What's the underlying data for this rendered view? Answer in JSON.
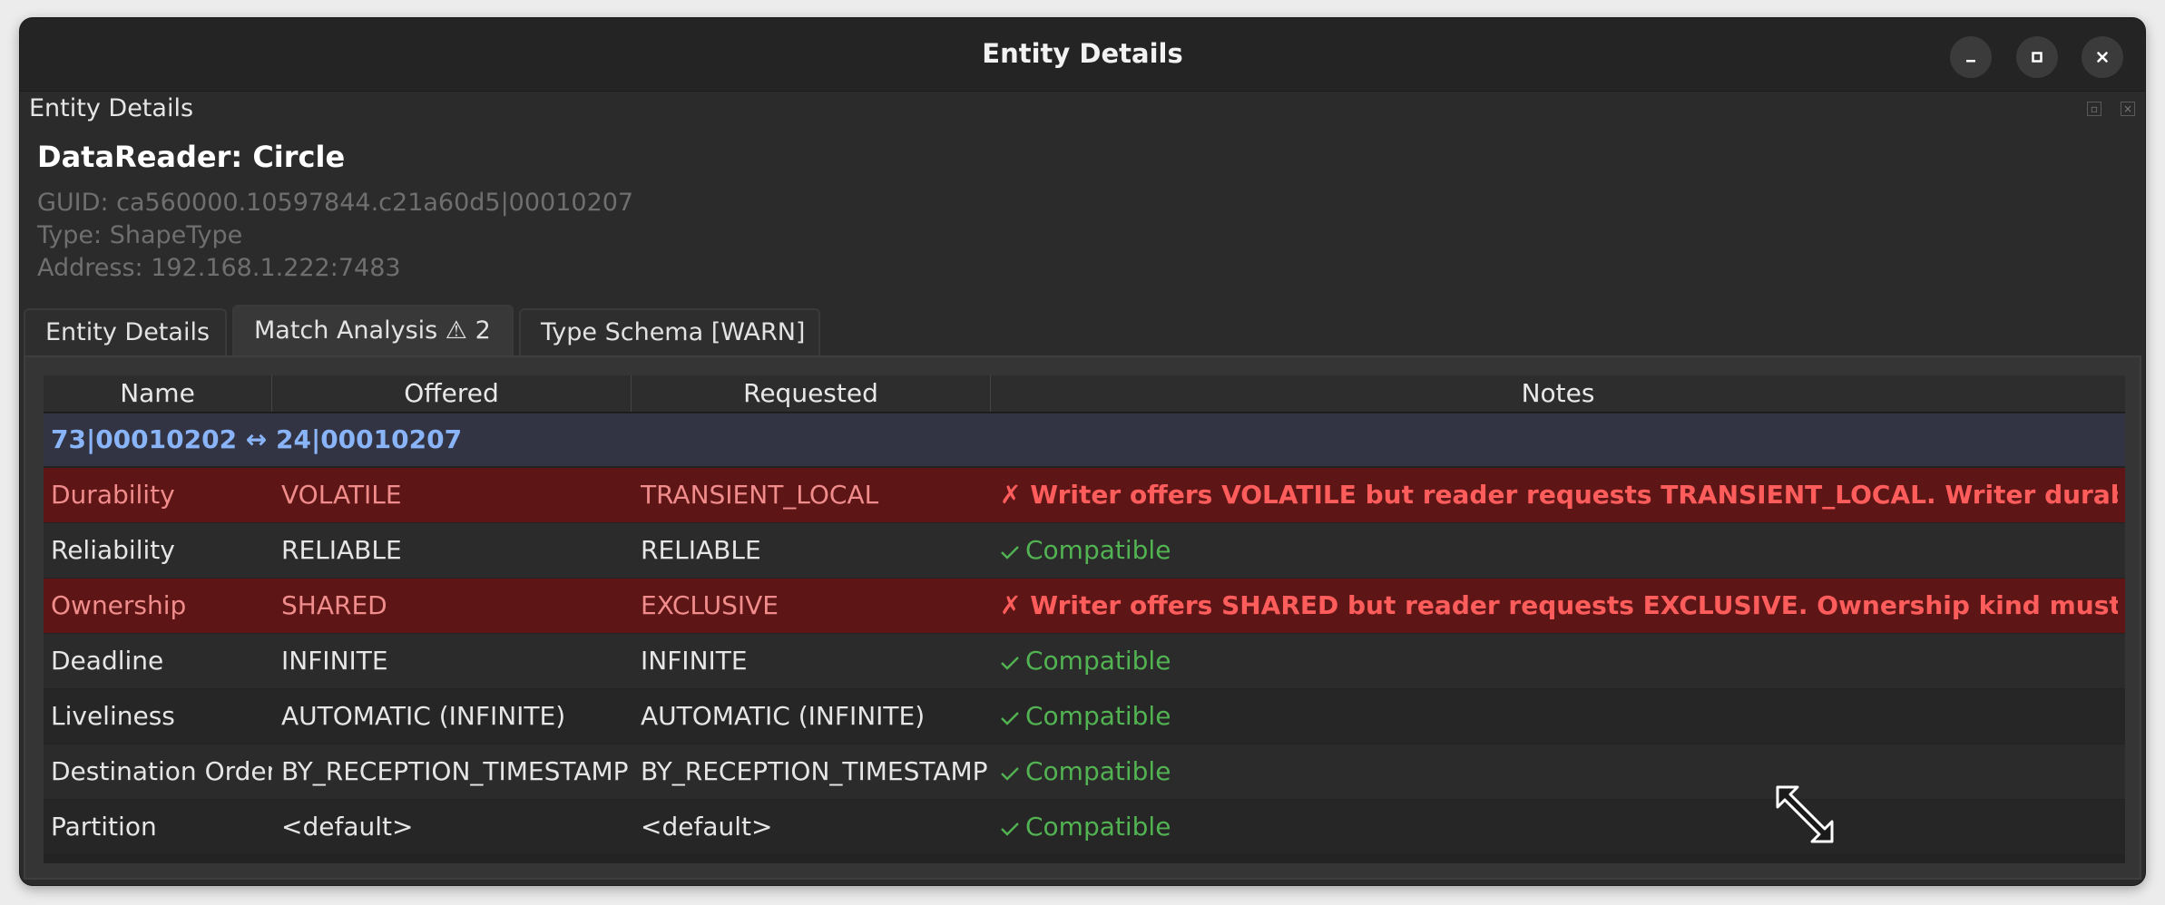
{
  "window": {
    "title": "Entity Details"
  },
  "dock": {
    "title": "Entity Details"
  },
  "entity": {
    "title": "DataReader: Circle",
    "guid": "GUID: ca560000.10597844.c21a60d5|00010207",
    "type": "Type: ShapeType",
    "address": "Address: 192.168.1.222:7483"
  },
  "tabs": [
    {
      "label": "Entity Details",
      "active": false
    },
    {
      "label": "Match Analysis  ⚠ 2",
      "active": true
    },
    {
      "label": "Type Schema [WARN]",
      "active": false
    }
  ],
  "table": {
    "headers": [
      "Name",
      "Offered",
      "Requested",
      "Notes"
    ],
    "group": "73|00010202 ↔ 24|00010207",
    "rows": [
      {
        "name": "Durability",
        "offered": "VOLATILE",
        "requested": "TRANSIENT_LOCAL",
        "status": "mismatch",
        "note": "✗ Writer offers VOLATILE but reader requests TRANSIENT_LOCAL. Writer durability ..."
      },
      {
        "name": "Reliability",
        "offered": "RELIABLE",
        "requested": "RELIABLE",
        "status": "ok",
        "note": "Compatible"
      },
      {
        "name": "Ownership",
        "offered": "SHARED",
        "requested": "EXCLUSIVE",
        "status": "mismatch",
        "note": "✗ Writer offers SHARED but reader requests EXCLUSIVE. Ownership kind must match..."
      },
      {
        "name": "Deadline",
        "offered": "INFINITE",
        "requested": "INFINITE",
        "status": "ok",
        "note": "Compatible"
      },
      {
        "name": "Liveliness",
        "offered": "AUTOMATIC (INFINITE)",
        "requested": "AUTOMATIC (INFINITE)",
        "status": "ok",
        "note": "Compatible"
      },
      {
        "name": "Destination Order",
        "offered": "BY_RECEPTION_TIMESTAMP",
        "requested": "BY_RECEPTION_TIMESTAMP",
        "status": "ok",
        "note": "Compatible"
      },
      {
        "name": "Partition",
        "offered": "<default>",
        "requested": "<default>",
        "status": "ok",
        "note": "Compatible"
      }
    ]
  },
  "icons": {
    "minimize": "minimize-icon",
    "maximize": "maximize-icon",
    "close": "close-icon",
    "check": "check-icon",
    "cursor": "resize-diagonal-cursor-icon"
  },
  "colors": {
    "mismatch_row": "#5e1515",
    "error_text": "#ff5c5c",
    "ok_text": "#52b352",
    "group_text": "#8ab4f8"
  }
}
